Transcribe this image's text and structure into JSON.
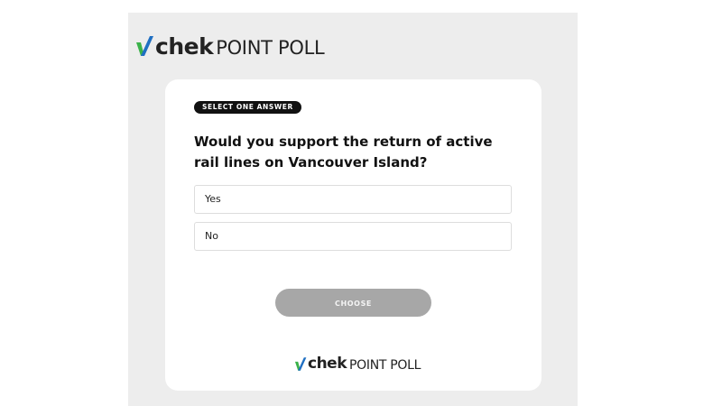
{
  "brand": {
    "word": "chek",
    "suffix": "POINT POLL",
    "colors": {
      "check_green": "#3bb24a",
      "check_blue": "#1f6fc2",
      "text": "#222222"
    }
  },
  "poll": {
    "badge": "SELECT ONE ANSWER",
    "question": "Would you support the return of active rail lines on Vancouver Island?",
    "options": [
      "Yes",
      "No"
    ],
    "submit_label": "CHOOSE",
    "submit_state": "disabled"
  },
  "footer": {
    "word": "chek",
    "suffix": "POINT POLL"
  }
}
